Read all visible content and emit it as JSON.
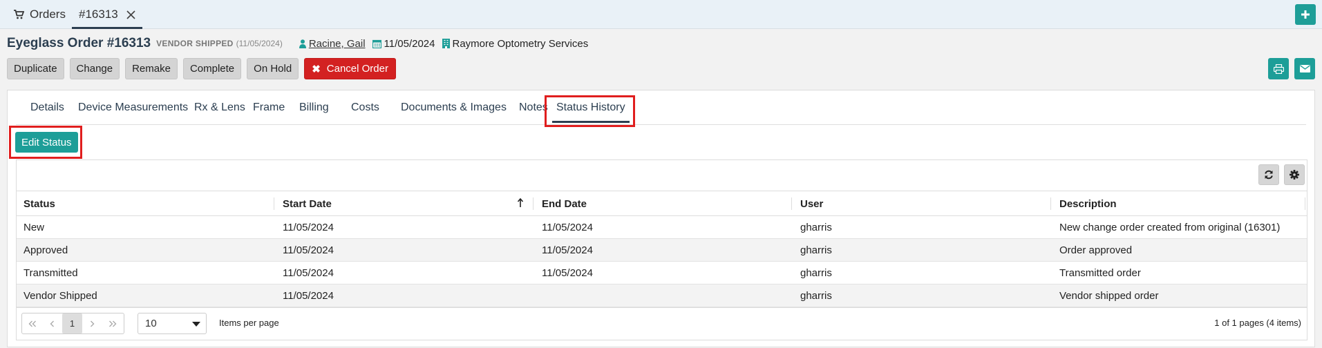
{
  "top_tabs": [
    {
      "label": "Orders",
      "icon": "cart-icon"
    },
    {
      "label": "#16313",
      "icon": "close-icon"
    }
  ],
  "header": {
    "title": "Eyeglass Order #16313",
    "status": "VENDOR SHIPPED",
    "status_date": "(11/05/2024)",
    "patient": "Racine, Gail",
    "date": "11/05/2024",
    "location": "Raymore Optometry Services"
  },
  "actions": {
    "duplicate": "Duplicate",
    "change": "Change",
    "remake": "Remake",
    "complete": "Complete",
    "on_hold": "On Hold",
    "cancel": "Cancel Order",
    "cancel_icon": "✖"
  },
  "tabs": [
    "Details",
    "Device Measurements",
    "Rx & Lens",
    "Frame",
    "Billing",
    "Costs",
    "Documents & Images",
    "Notes",
    "Status History"
  ],
  "active_tab": "Status History",
  "edit_status_label": "Edit Status",
  "grid": {
    "columns": [
      "Status",
      "Start Date",
      "End Date",
      "User",
      "Description"
    ],
    "rows": [
      {
        "status": "New",
        "start": "11/05/2024",
        "end": "11/05/2024",
        "user": "gharris",
        "description": "New change order created from original (16301)"
      },
      {
        "status": "Approved",
        "start": "11/05/2024",
        "end": "11/05/2024",
        "user": "gharris",
        "description": "Order approved"
      },
      {
        "status": "Transmitted",
        "start": "11/05/2024",
        "end": "11/05/2024",
        "user": "gharris",
        "description": "Transmitted order"
      },
      {
        "status": "Vendor Shipped",
        "start": "11/05/2024",
        "end": "",
        "user": "gharris",
        "description": "Vendor shipped order"
      }
    ]
  },
  "pager": {
    "current_page": "1",
    "page_size": "10",
    "items_per_page_label": "Items per page",
    "info": "1 of 1 pages (4 items)"
  },
  "colors": {
    "teal": "#1d9e98",
    "danger": "#d32121",
    "highlight": "#e01e1e",
    "navy": "#2b3e50"
  }
}
